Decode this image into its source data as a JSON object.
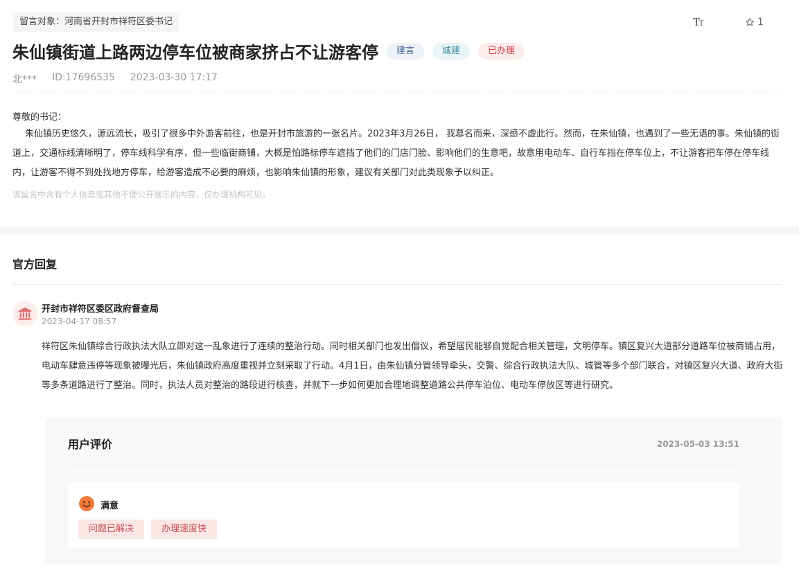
{
  "header": {
    "target_label": "留言对象：河南省开封市祥符区委书记",
    "font_toggle_large": "T",
    "font_toggle_small": "T",
    "favorite_count": "1",
    "title": "朱仙镇街道上路两边停车位被商家挤占不让游客停",
    "tags": [
      "建言",
      "城建",
      "已办理"
    ],
    "author": "北***",
    "id_text": "ID:17696535",
    "datetime": "2023-03-30 17:17"
  },
  "message": {
    "greeting": "尊敬的书记：",
    "body": "朱仙镇历史悠久，源远流长，吸引了很多中外游客前往，也是开封市旅游的一张名片。2023年3月26日， 我慕名而来，深感不虚此行。然而，在朱仙镇，也遇到了一些无语的事。朱仙镇的街道上，交通标线清晰明了，停车线科学有序，但一些临街商铺，大概是怕路标停车遮挡了他们的门店门脸、影响他们的生意吧，故意用电动车、自行车挡在停车位上，不让游客把车停在停车线内，让游客不得不到处找地方停车，给游客造成不必要的麻烦，也影响朱仙镇的形象，建议有关部门对此类现象予以纠正。",
    "privacy_note": "该留言中含有个人信息或其他不便公开展示的内容，仅办理机构可见。"
  },
  "reply": {
    "section_title": "官方回复",
    "org_name": "开封市祥符区委区政府督查局",
    "datetime": "2023-04-17 08:57",
    "body": "祥符区朱仙镇综合行政执法大队立即对这一乱象进行了连续的整治行动。同时相关部门也发出倡议，希望居民能够自觉配合相关管理，文明停车。镇区复兴大道部分道路车位被商铺占用，电动车肆意违停等现象被曝光后，朱仙镇政府高度重视并立刻采取了行动。4月1日，由朱仙镇分管领导牵头，交警、综合行政执法大队、城管等多个部门联合，对镇区复兴大道、政府大街等多条道路进行了整治。同时，执法人员对整治的路段进行核查，并就下一步如何更加合理地调整道路公共停车泊位、电动车停放区等进行研究。"
  },
  "evaluation": {
    "title": "用户评价",
    "datetime": "2023-05-03 13:51",
    "satisfaction": "满意",
    "chips": [
      "问题已解决",
      "办理速度快"
    ]
  },
  "colors": {
    "accent_red": "#d04848",
    "smiley_orange": "#f07a3a"
  },
  "icons": [
    "font-size-icon",
    "star-icon",
    "government-building-icon",
    "smiley-icon"
  ]
}
